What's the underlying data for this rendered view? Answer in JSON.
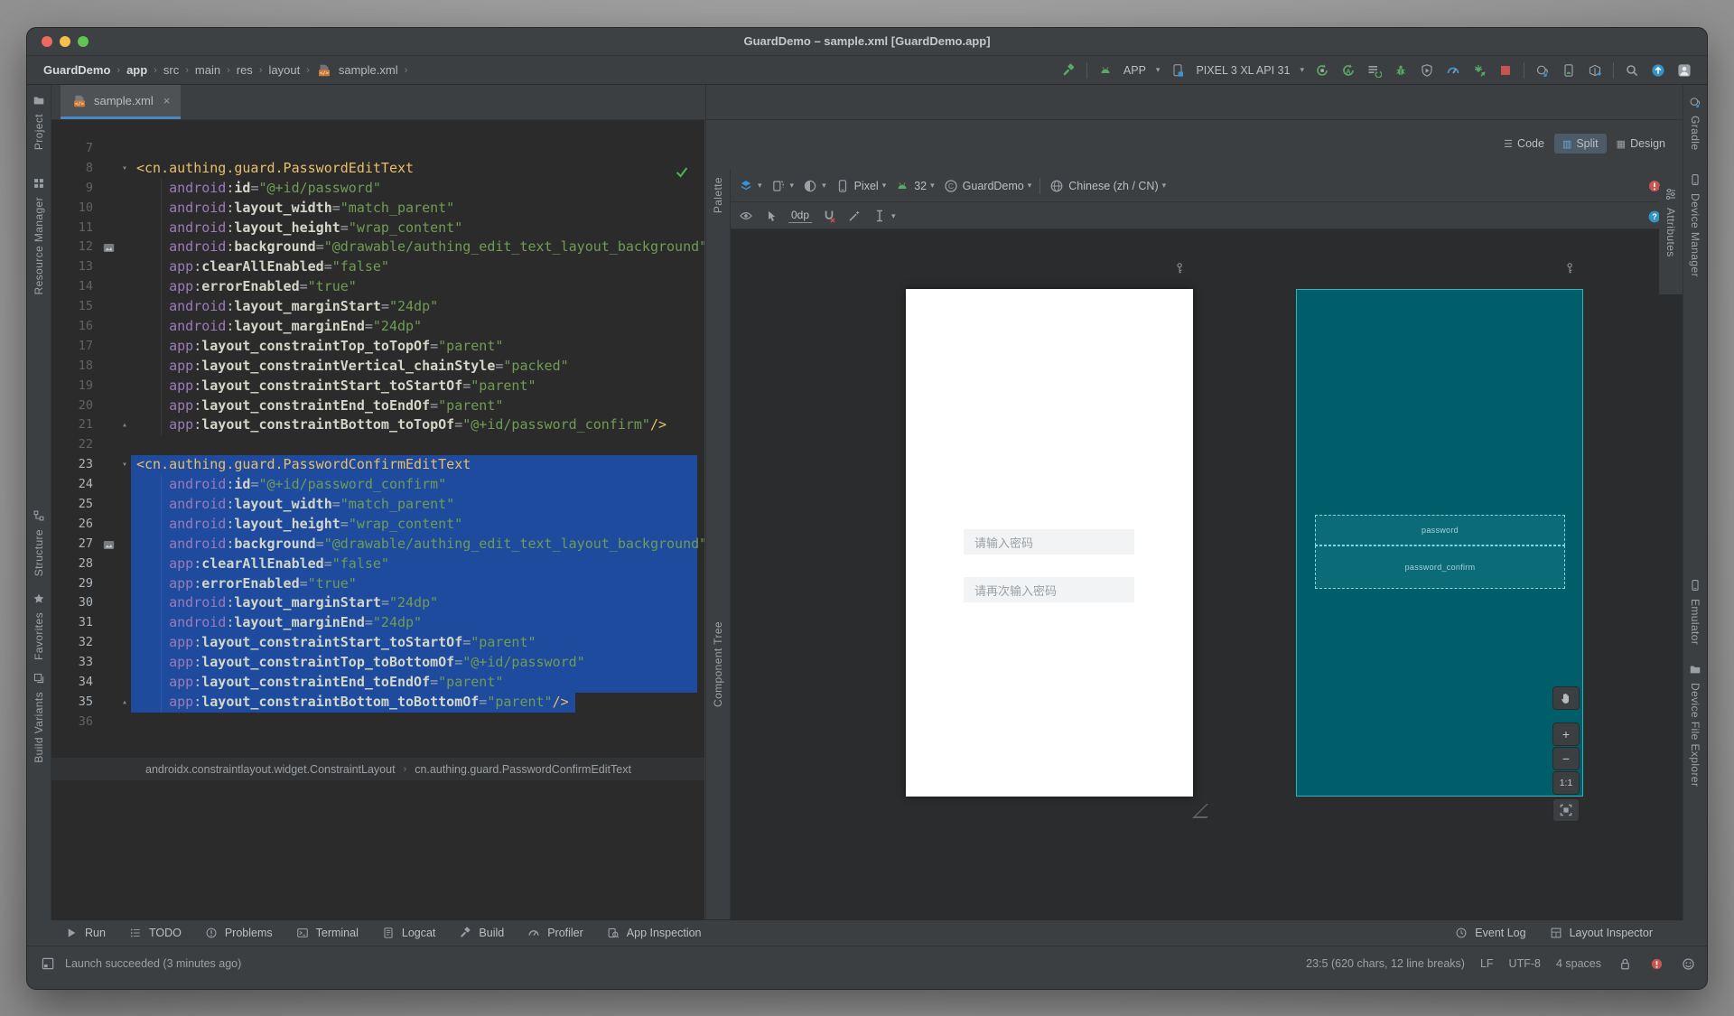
{
  "window_title": "GuardDemo – sample.xml [GuardDemo.app]",
  "path_bar": {
    "items": [
      "GuardDemo",
      "app",
      "src",
      "main",
      "res",
      "layout",
      "sample.xml"
    ]
  },
  "run_bar": {
    "config": "APP",
    "device": "PIXEL 3 XL API 31"
  },
  "tabs": {
    "active": "sample.xml",
    "close_glyph": "×"
  },
  "view_modes": {
    "items": [
      "Code",
      "Split",
      "Design"
    ],
    "active": "Split"
  },
  "design_bar": {
    "device": "Pixel",
    "api": "32",
    "theme": "GuardDemo",
    "locale": "Chinese (zh / CN)",
    "default_margin": "0dp",
    "issue_badge": "!",
    "help_badge": "?"
  },
  "palette_label": "Palette",
  "component_tree_label": "Component Tree",
  "left_stripe": [
    "Project",
    "Resource Manager",
    "Structure",
    "Favorites",
    "Build Variants"
  ],
  "right_stripe": [
    "Gradle",
    "Device Manager",
    "Attributes",
    "Emulator",
    "Device File Explorer"
  ],
  "preview": {
    "fields": [
      "请输入密码",
      "请再次输入密码"
    ],
    "blueprint": [
      "password",
      "password_confirm"
    ],
    "zoom_label": "1:1",
    "zoom_plus": "+",
    "zoom_minus": "−"
  },
  "xml_breadcrumb": [
    "androidx.constraintlayout.widget.ConstraintLayout",
    "cn.authing.guard.PasswordConfirmEditText"
  ],
  "tool_buttons": [
    "Run",
    "TODO",
    "Problems",
    "Terminal",
    "Logcat",
    "Build",
    "Profiler",
    "App Inspection"
  ],
  "tool_buttons_right": [
    "Event Log",
    "Layout Inspector"
  ],
  "status": {
    "message": "Launch succeeded (3 minutes ago)",
    "caret": "23:5 (620 chars, 12 line breaks)",
    "eol": "LF",
    "encoding": "UTF-8",
    "indent": "4 spaces"
  },
  "colors": {
    "accent_blue": "#4a88c7",
    "selection_blue": "#1e4b9e",
    "blueprint_teal": "#005e6a",
    "tag_yellow": "#e8bf6a",
    "string_green": "#6f9c54",
    "namespace_purple": "#9b7bb8",
    "stop_red": "#c75450",
    "run_green": "#59a869"
  },
  "icons": [
    "build-hammer-icon",
    "android-icon",
    "device-icon",
    "chevron-down-icon",
    "apply-changes-icon",
    "apply-code-changes-icon",
    "rerun-tasks-icon",
    "debug-icon",
    "attach-debugger-icon",
    "profiler-icon",
    "sync-project-icon",
    "stop-icon",
    "gradle-sync-icon",
    "device-sync-icon",
    "sdk-manager-icon",
    "search-icon",
    "update-icon",
    "avatar-icon",
    "xml-file-icon",
    "close-icon",
    "layers-icon",
    "orientation-icon",
    "night-mode-icon",
    "theme-icon",
    "locale-globe-icon",
    "eye-icon",
    "cursor-icon",
    "magnet-icon",
    "infer-constraints-icon",
    "text-tool-icon",
    "inspections-ok-icon",
    "key-icon",
    "pan-hand-icon",
    "fit-screen-icon",
    "folder-icon",
    "resource-grid-icon",
    "structure-icon",
    "favorites-star-icon",
    "build-variants-icon",
    "sliders-icon",
    "clock-icon",
    "layout-inspector-icon",
    "run-icon",
    "todo-icon",
    "problems-icon",
    "terminal-icon",
    "logcat-icon",
    "hammer-icon",
    "gauge-icon",
    "app-inspection-icon",
    "lock-icon",
    "error-badge-icon",
    "help-badge-icon",
    "smiley-icon",
    "toolwindow-icon",
    "image-preview-icon"
  ],
  "code": {
    "lines": [
      {
        "n": 7
      },
      {
        "n": 8,
        "tag": "<cn.authing.guard.PasswordEditText",
        "fold": "open"
      },
      {
        "n": 9,
        "ns": "android",
        "attr": "id",
        "val": "@+id/password"
      },
      {
        "n": 10,
        "ns": "android",
        "attr": "layout_width",
        "val": "match_parent"
      },
      {
        "n": 11,
        "ns": "android",
        "attr": "layout_height",
        "val": "wrap_content"
      },
      {
        "n": 12,
        "ns": "android",
        "attr": "background",
        "val": "@drawable/authing_edit_text_layout_background",
        "img": true
      },
      {
        "n": 13,
        "ns": "app",
        "attr": "clearAllEnabled",
        "val": "false"
      },
      {
        "n": 14,
        "ns": "app",
        "attr": "errorEnabled",
        "val": "true"
      },
      {
        "n": 15,
        "ns": "android",
        "attr": "layout_marginStart",
        "val": "24dp"
      },
      {
        "n": 16,
        "ns": "android",
        "attr": "layout_marginEnd",
        "val": "24dp"
      },
      {
        "n": 17,
        "ns": "app",
        "attr": "layout_constraintTop_toTopOf",
        "val": "parent"
      },
      {
        "n": 18,
        "ns": "app",
        "attr": "layout_constraintVertical_chainStyle",
        "val": "packed"
      },
      {
        "n": 19,
        "ns": "app",
        "attr": "layout_constraintStart_toStartOf",
        "val": "parent"
      },
      {
        "n": 20,
        "ns": "app",
        "attr": "layout_constraintEnd_toEndOf",
        "val": "parent"
      },
      {
        "n": 21,
        "ns": "app",
        "attr": "layout_constraintBottom_toTopOf",
        "val": "@+id/password_confirm",
        "tail": "/>",
        "fold": "close"
      },
      {
        "n": 22
      },
      {
        "n": 23,
        "tag": "<cn.authing.guard.PasswordConfirmEditText",
        "fold": "open",
        "sel": true
      },
      {
        "n": 24,
        "ns": "android",
        "attr": "id",
        "val": "@+id/password_confirm",
        "sel": true
      },
      {
        "n": 25,
        "ns": "android",
        "attr": "layout_width",
        "val": "match_parent",
        "sel": true
      },
      {
        "n": 26,
        "ns": "android",
        "attr": "layout_height",
        "val": "wrap_content",
        "sel": true
      },
      {
        "n": 27,
        "ns": "android",
        "attr": "background",
        "val": "@drawable/authing_edit_text_layout_background",
        "img": true,
        "sel": true
      },
      {
        "n": 28,
        "ns": "app",
        "attr": "clearAllEnabled",
        "val": "false",
        "sel": true
      },
      {
        "n": 29,
        "ns": "app",
        "attr": "errorEnabled",
        "val": "true",
        "sel": true
      },
      {
        "n": 30,
        "ns": "android",
        "attr": "layout_marginStart",
        "val": "24dp",
        "sel": true
      },
      {
        "n": 31,
        "ns": "android",
        "attr": "layout_marginEnd",
        "val": "24dp",
        "sel": true
      },
      {
        "n": 32,
        "ns": "app",
        "attr": "layout_constraintStart_toStartOf",
        "val": "parent",
        "sel": true
      },
      {
        "n": 33,
        "ns": "app",
        "attr": "layout_constraintTop_toBottomOf",
        "val": "@+id/password",
        "sel": true
      },
      {
        "n": 34,
        "ns": "app",
        "attr": "layout_constraintEnd_toEndOf",
        "val": "parent",
        "sel": true
      },
      {
        "n": 35,
        "ns": "app",
        "attr": "layout_constraintBottom_toBottomOf",
        "val": "parent",
        "tail": "/>",
        "fold": "close",
        "sel": true,
        "end": true
      },
      {
        "n": 36
      }
    ]
  }
}
